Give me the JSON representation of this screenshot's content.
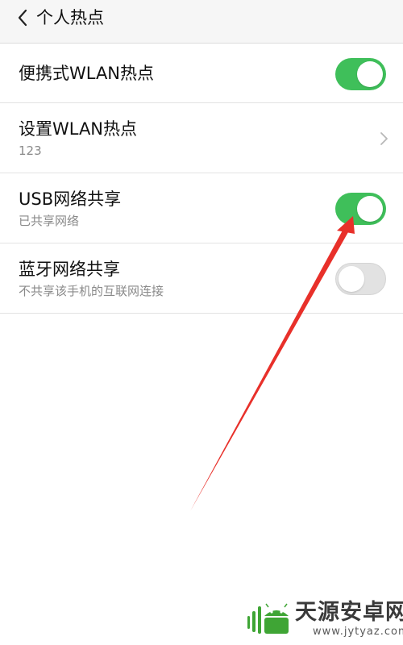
{
  "header": {
    "back_icon": "chevron-left-icon",
    "title": "个人热点"
  },
  "rows": [
    {
      "title": "便携式WLAN热点",
      "subtitle": "",
      "control": "toggle",
      "state": "on"
    },
    {
      "title": "设置WLAN热点",
      "subtitle": "123",
      "control": "chevron-right-icon"
    },
    {
      "title": "USB网络共享",
      "subtitle": "已共享网络",
      "control": "toggle",
      "state": "on"
    },
    {
      "title": "蓝牙网络共享",
      "subtitle": "不共享该手机的互联网连接",
      "control": "toggle",
      "state": "off"
    }
  ],
  "colors": {
    "toggle_on": "#3fbf5a",
    "toggle_off": "#e2e2e2",
    "annotation_arrow": "#e8302a",
    "watermark_green": "#3fa535"
  },
  "watermark": {
    "brand": "天源安卓网",
    "url": "www.jytyaz.com"
  }
}
